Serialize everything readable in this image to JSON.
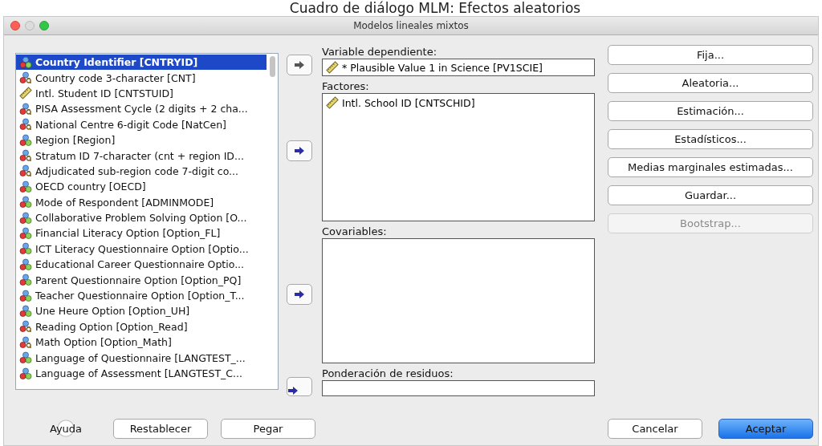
{
  "caption": "Cuadro de diálogo MLM: Efectos aleatorios",
  "window": {
    "title": "Modelos lineales mixtos"
  },
  "variables": [
    {
      "label": "Country Identifier [CNTRYID]",
      "kind": "nominal",
      "selected": true
    },
    {
      "label": "Country code 3-character [CNT]",
      "kind": "nominal-string",
      "selected": false
    },
    {
      "label": "Intl. Student ID [CNTSTUID]",
      "kind": "scale",
      "selected": false
    },
    {
      "label": "PISA Assessment Cycle (2 digits + 2 cha...",
      "kind": "nominal-string",
      "selected": false
    },
    {
      "label": "National Centre 6-digit Code [NatCen]",
      "kind": "nominal-string",
      "selected": false
    },
    {
      "label": "Region [Region]",
      "kind": "nominal",
      "selected": false
    },
    {
      "label": "Stratum ID 7-character (cnt + region ID...",
      "kind": "nominal-string",
      "selected": false
    },
    {
      "label": "Adjudicated sub-region code 7-digit co...",
      "kind": "nominal-string",
      "selected": false
    },
    {
      "label": "OECD country [OECD]",
      "kind": "nominal",
      "selected": false
    },
    {
      "label": "Mode of Respondent [ADMINMODE]",
      "kind": "nominal",
      "selected": false
    },
    {
      "label": "Collaborative Problem Solving Option [O...",
      "kind": "nominal",
      "selected": false
    },
    {
      "label": "Financial Literacy Option [Option_FL]",
      "kind": "nominal",
      "selected": false
    },
    {
      "label": "ICT Literacy Questionnaire Option [Optio...",
      "kind": "nominal",
      "selected": false
    },
    {
      "label": "Educational Career Questionnaire Optio...",
      "kind": "nominal",
      "selected": false
    },
    {
      "label": "Parent Questionnaire Option [Option_PQ]",
      "kind": "nominal",
      "selected": false
    },
    {
      "label": "Teacher Questionnaire Option [Option_T...",
      "kind": "nominal",
      "selected": false
    },
    {
      "label": "Une Heure Option [Option_UH]",
      "kind": "nominal",
      "selected": false
    },
    {
      "label": "Reading Option [Option_Read]",
      "kind": "nominal-string",
      "selected": false
    },
    {
      "label": "Math Option [Option_Math]",
      "kind": "nominal-string",
      "selected": false
    },
    {
      "label": "Language of Questionnaire [LANGTEST_...",
      "kind": "nominal",
      "selected": false
    },
    {
      "label": "Language of Assessment [LANGTEST_C...",
      "kind": "nominal",
      "selected": false
    }
  ],
  "dependent": {
    "label": "Variable dependiente:",
    "arrow_disabled": true,
    "value": {
      "label": "* Plausible Value 1 in Science [PV1SCIE]",
      "kind": "scale"
    }
  },
  "factors": {
    "label": "Factores:",
    "arrow_disabled": false,
    "items": [
      {
        "label": "Intl. School ID [CNTSCHID]",
        "kind": "scale"
      }
    ]
  },
  "covariates": {
    "label": "Covariables:",
    "arrow_disabled": false
  },
  "weights": {
    "label": "Ponderación de residuos:",
    "arrow_disabled": false
  },
  "side_buttons": [
    {
      "label": "Fija...",
      "disabled": false
    },
    {
      "label": "Aleatoria...",
      "disabled": false
    },
    {
      "label": "Estimación...",
      "disabled": false
    },
    {
      "label": "Estadísticos...",
      "disabled": false
    },
    {
      "label": "Medias marginales estimadas...",
      "disabled": false
    },
    {
      "label": "Guardar...",
      "disabled": false
    },
    {
      "label": "Bootstrap...",
      "disabled": true
    }
  ],
  "help": "Ayuda",
  "left_buttons": [
    "Restablecer",
    "Pegar"
  ],
  "cancel": "Cancelar",
  "ok": "Aceptar"
}
